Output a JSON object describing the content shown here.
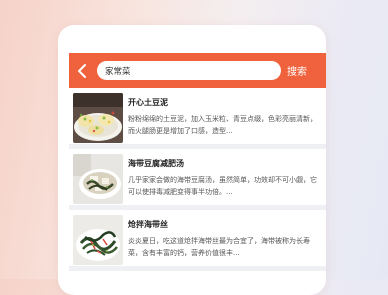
{
  "search": {
    "value": "家常菜",
    "button_label": "搜索"
  },
  "recipes": [
    {
      "title": "开心土豆泥",
      "desc": "粉粉绵绵的土豆泥，加入玉米粒、青豆点缀，色彩亮丽清新，而火腿肠更是增加了口感，造型..."
    },
    {
      "title": "海带豆腐减肥汤",
      "desc": "几乎家家会做的海带豆腐汤，虽然简单，功效却不可小觑，它可以使排毒减肥变得事半功倍。..."
    },
    {
      "title": "炝拌海带丝",
      "desc": "炎炎夏日，吃这道炝拌海带丝最为合宜了，海带被称为长寿菜，含有丰富的钙，营养价值很丰..."
    }
  ],
  "colors": {
    "accent": "#f0623d"
  }
}
